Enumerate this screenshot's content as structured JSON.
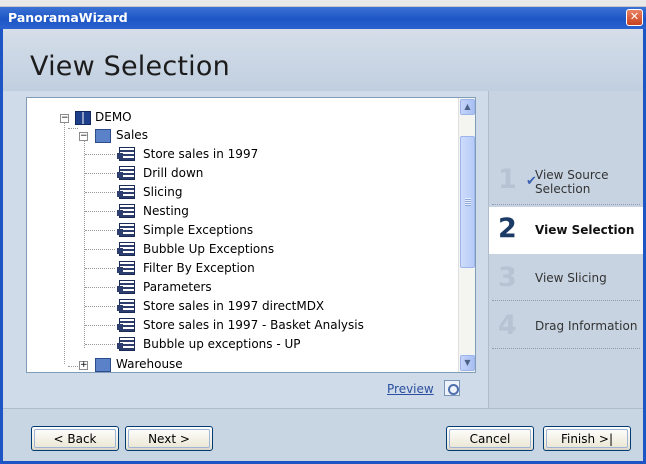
{
  "window": {
    "title": "PanoramaWizard",
    "close_glyph": "✕"
  },
  "header": {
    "title": "View Selection"
  },
  "tree": {
    "root": {
      "label": "DEMO",
      "expander": "−",
      "icon": "book-icon"
    },
    "sales": {
      "label": "Sales",
      "expander": "−",
      "icon": "folder-icon"
    },
    "views": [
      "Store sales in 1997",
      "Drill down",
      "Slicing",
      "Nesting",
      "Simple Exceptions",
      "Bubble Up Exceptions",
      "Filter By Exception",
      "Parameters",
      "Store sales in 1997 directMDX",
      "Store sales in 1997 - Basket Analysis",
      "Bubble up exceptions - UP"
    ],
    "warehouse": {
      "label": "Warehouse",
      "expander": "+",
      "icon": "folder-icon"
    }
  },
  "scroll": {
    "up_glyph": "▲",
    "down_glyph": "▼"
  },
  "preview": {
    "label": "Preview"
  },
  "steps": [
    {
      "num": "1",
      "line1": "View Source",
      "line2": "Selection",
      "state": "done",
      "check": "✔"
    },
    {
      "num": "2",
      "line1": "View Selection",
      "state": "active"
    },
    {
      "num": "3",
      "line1": "View Slicing",
      "state": "pending"
    },
    {
      "num": "4",
      "line1": "Drag Information",
      "state": "pending"
    }
  ],
  "buttons": {
    "back": "< Back",
    "next": "Next >",
    "cancel": "Cancel",
    "finish": "Finish >|"
  },
  "colors": {
    "title_bar": "#1d55c4",
    "accent_link": "#2a4fa0",
    "active_step_bg": "#ffffff"
  }
}
